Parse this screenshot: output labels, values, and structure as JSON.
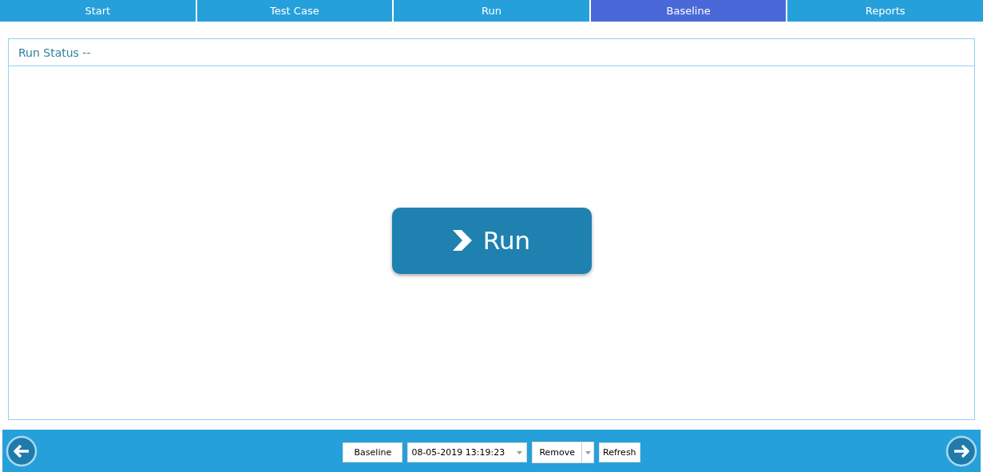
{
  "tabs": [
    {
      "label": "Start",
      "selected": false
    },
    {
      "label": "Test Case",
      "selected": false
    },
    {
      "label": "Run",
      "selected": false
    },
    {
      "label": "Baseline",
      "selected": true
    },
    {
      "label": "Reports",
      "selected": false
    }
  ],
  "panel": {
    "title": "Run Status --",
    "run_button": "Run"
  },
  "footer": {
    "baseline_button": "Baseline",
    "date_select": "08-05-2019 13:19:23",
    "remove_button": "Remove",
    "refresh_button": "Refresh"
  }
}
